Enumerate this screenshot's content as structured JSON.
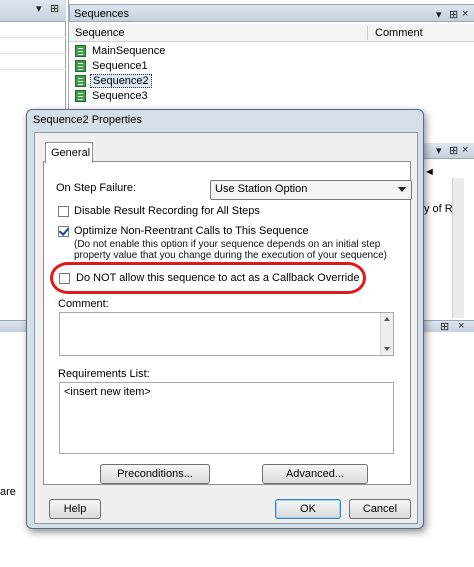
{
  "left_pane": {
    "title_buttons": [
      "▾",
      "⊞"
    ],
    "fragment": "are"
  },
  "sequences_pane": {
    "title": "Sequences",
    "title_buttons": [
      "▾",
      "⊞",
      "×"
    ],
    "columns": [
      "Sequence",
      "Comment"
    ],
    "items": [
      "MainSequence",
      "Sequence1",
      "Sequence2",
      "Sequence3"
    ],
    "selected": "Sequence2",
    "mid_buttons": [
      "▾",
      "⊞",
      "×"
    ],
    "mid_text_1": "◄",
    "mid_text_2": "y of Re",
    "bottom_buttons": [
      "⊞",
      "×"
    ]
  },
  "dialog": {
    "title": "Sequence2 Properties",
    "tab": "General",
    "on_step_failure_label": "On Step Failure:",
    "on_step_failure_value": "Use Station Option",
    "disable_result_label": "Disable Result Recording for All Steps",
    "disable_result_checked": false,
    "optimize_label": "Optimize Non-Reentrant Calls to This Sequence",
    "optimize_checked": true,
    "optimize_note": "(Do not enable this option if your sequence depends on an initial step property value that you change during the execution of your sequence)",
    "callback_label": "Do NOT allow this sequence to act as a Callback Override",
    "callback_checked": false,
    "comment_label": "Comment:",
    "comment_value": "",
    "requirements_label": "Requirements List:",
    "requirements_items": [
      "<insert new item>"
    ],
    "preconditions_button": "Preconditions...",
    "advanced_button": "Advanced...",
    "help_button": "Help",
    "ok_button": "OK",
    "cancel_button": "Cancel",
    "highlight_color": "#e01818"
  }
}
